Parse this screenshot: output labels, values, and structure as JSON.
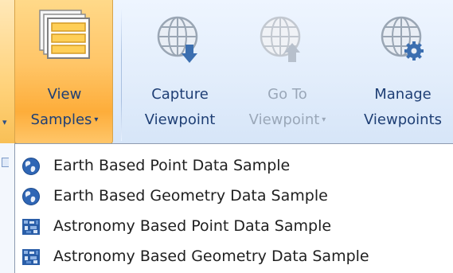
{
  "ribbon": {
    "view_samples": {
      "line1": "View",
      "line2": "Samples",
      "arrow": "▾",
      "icon": "sample-windows-icon"
    },
    "capture": {
      "line1": "Capture",
      "line2": "Viewpoint",
      "icon": "globe-down-arrow-icon"
    },
    "goto": {
      "line1": "Go To",
      "line2": "Viewpoint",
      "arrow": "▾",
      "icon": "globe-up-arrow-icon",
      "disabled": true
    },
    "manage": {
      "line1": "Manage",
      "line2": "Viewpoints",
      "icon": "globe-gear-icon"
    },
    "left_stub_arrow": "▾"
  },
  "menu": {
    "items": [
      {
        "label": "Earth Based Point Data Sample",
        "icon": "earth-globe-icon"
      },
      {
        "label": "Earth Based Geometry Data Sample",
        "icon": "earth-globe-icon"
      },
      {
        "label": "Astronomy Based Point Data Sample",
        "icon": "astronomy-image-icon"
      },
      {
        "label": "Astronomy Based Geometry Data Sample",
        "icon": "astronomy-image-icon"
      }
    ]
  },
  "colors": {
    "active_button": "#ffc567",
    "ribbon_bg": "#e2edfb",
    "ribbon_text": "#1f3f75",
    "disabled_text": "#9aa7b8"
  }
}
